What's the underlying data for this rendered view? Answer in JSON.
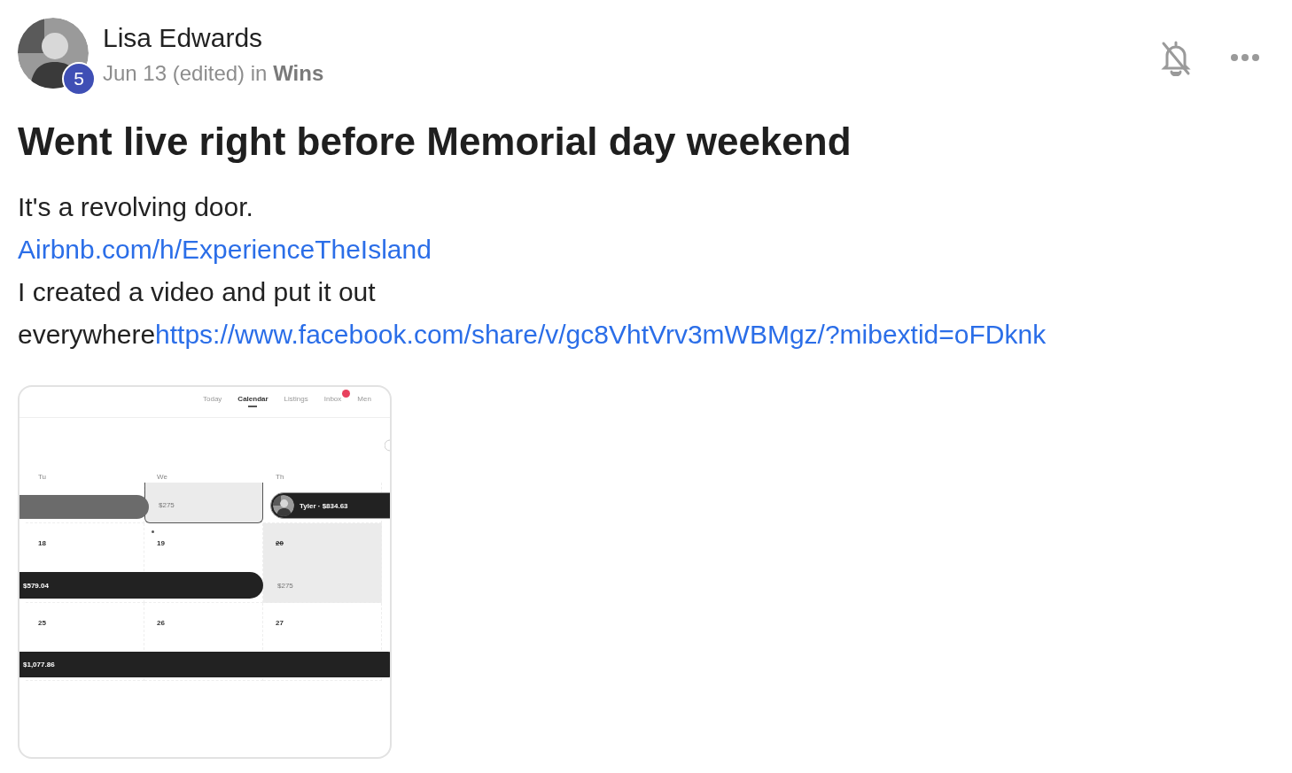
{
  "post": {
    "author": "Lisa Edwards",
    "badge": "5",
    "meta": "Jun 13 (edited) in **Wins**",
    "muted": true,
    "title": "Went live right before Memorial day weekend",
    "body": [
      {
        "kind": "text",
        "text": "It's a revolving door."
      },
      {
        "kind": "link",
        "text": "Airbnb.com/h/ExperienceTheIsland"
      },
      {
        "kind": "text",
        "text": "I created a video and put it out"
      },
      {
        "kind": "mixed",
        "text": "everywhere",
        "link": "https://www.facebook.com/share/v/gc8VhtVrv3mWBMgz/?mibextid=oFDknk"
      }
    ]
  },
  "attachment": {
    "tabs": [
      {
        "label": "Today",
        "selected": false,
        "notification": false
      },
      {
        "label": "Calendar",
        "selected": true,
        "notification": false
      },
      {
        "label": "Listings",
        "selected": false,
        "notification": false
      },
      {
        "label": "Inbox",
        "selected": false,
        "notification": true
      },
      {
        "label": "Men",
        "selected": false,
        "notification": false
      }
    ],
    "days": [
      "Tu",
      "We",
      "Th"
    ],
    "weeks": [
      {
        "cells": [
          {
            "kind": "open"
          },
          {
            "kind": "selected",
            "price": "$275"
          },
          {
            "kind": "open"
          }
        ],
        "bars": [
          {
            "kind": "past"
          },
          {
            "kind": "guest",
            "label": "Tyler · $834.63",
            "avatar": true
          }
        ]
      },
      {
        "cells": [
          {
            "kind": "open",
            "number": "18"
          },
          {
            "kind": "open",
            "number": "19",
            "dot": true
          },
          {
            "kind": "blocked",
            "number": "20",
            "struck": true,
            "price": "$275"
          }
        ],
        "bars": [
          {
            "kind": "guest",
            "label": "$579.04",
            "avatar": false
          }
        ]
      },
      {
        "cells": [
          {
            "kind": "open",
            "number": "25"
          },
          {
            "kind": "open",
            "number": "26"
          },
          {
            "kind": "open",
            "number": "27"
          }
        ],
        "bars": [
          {
            "kind": "guest",
            "label": "$1,077.86",
            "avatar": false
          }
        ]
      }
    ]
  }
}
